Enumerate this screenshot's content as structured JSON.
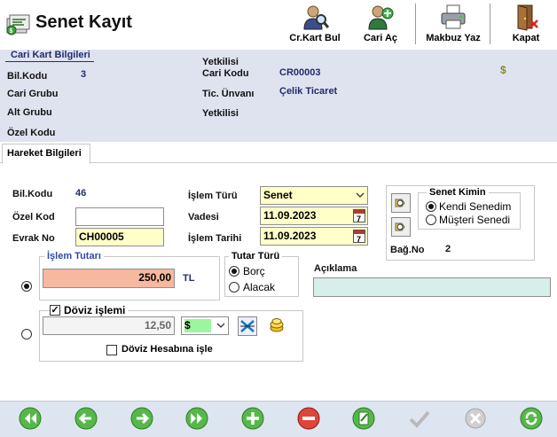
{
  "window": {
    "title": "Senet Kayıt"
  },
  "toolbar": {
    "find": "Cr.Kart Bul",
    "open": "Cari Aç",
    "print": "Makbuz Yaz",
    "close": "Kapat"
  },
  "cari": {
    "section_title": "Cari Kart Bilgileri",
    "bilkodu_label": "Bil.Kodu",
    "bilkodu_value": "3",
    "cari_grubu_label": "Cari Grubu",
    "alt_grubu_label": "Alt Grubu",
    "ozel_kodu_label": "Özel Kodu",
    "yetkilisi_top_label": "Yetkilisi",
    "cari_kodu_label": "Cari Kodu",
    "cari_kodu_value": "CR00003",
    "unvan_label": "Tic. Ünvanı",
    "unvan_value": "Çelik Ticaret",
    "yetkilisi_label": "Yetkilisi",
    "currency_symbol": "$"
  },
  "tabs": {
    "hareket": "Hareket Bilgileri"
  },
  "hareket": {
    "bilkodu_label": "Bil.Kodu",
    "bilkodu_value": "46",
    "ozel_kod_label": "Özel Kod",
    "ozel_kod_value": "",
    "evrak_no_label": "Evrak No",
    "evrak_no_value": "CH00005",
    "islem_turu_label": "İşlem Türü",
    "islem_turu_value": "Senet",
    "vadesi_label": "Vadesi",
    "vadesi_value": "11.09.2023",
    "islem_tarihi_label": "İşlem Tarihi",
    "islem_tarihi_value": "11.09.2023",
    "cal_day": "7"
  },
  "senet_kimin": {
    "title": "Senet Kimin",
    "kendi": "Kendi Senedim",
    "musteri": "Müşteri Senedi",
    "bagno_label": "Bağ.No",
    "bagno_value": "2"
  },
  "tutar": {
    "group_title": "İşlem Tutarı",
    "amount": "250,00",
    "currency": "TL"
  },
  "tutar_turu": {
    "title": "Tutar Türü",
    "borc": "Borç",
    "alacak": "Alacak"
  },
  "aciklama": {
    "label": "Açıklama",
    "value": ""
  },
  "doviz": {
    "title": "Döviz işlemi",
    "amount": "12,50",
    "currency": "$",
    "hesap": "Döviz Hesabına işle"
  },
  "colors": {
    "header_bg": "#dfe3ef",
    "amount_bg": "#f7b8a0",
    "yellow_field": "#ffffc8",
    "aciklama_bg": "#d8eeea",
    "footer_bg": "#dde6f0",
    "accent": "#2f4aa8"
  }
}
